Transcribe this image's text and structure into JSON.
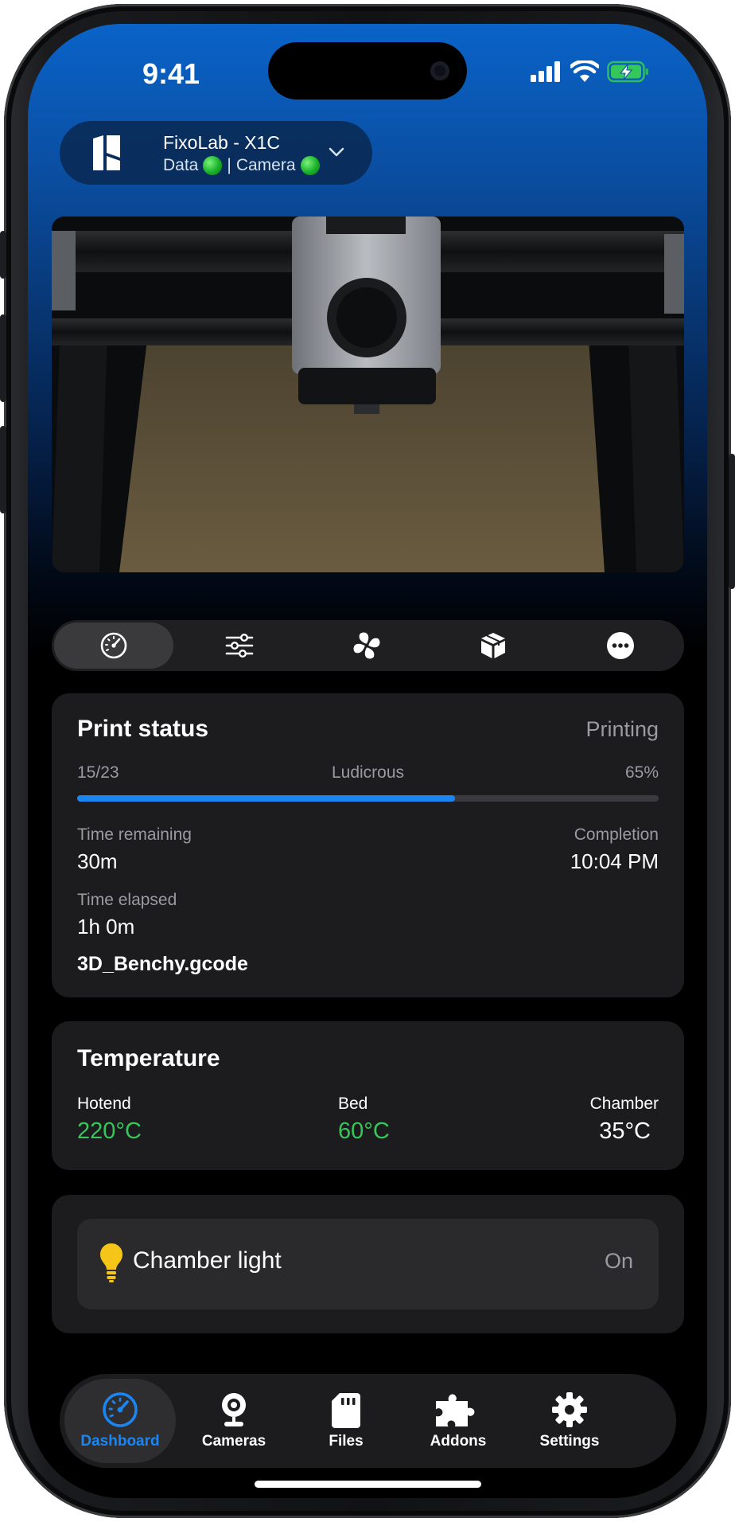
{
  "status_bar": {
    "time": "9:41"
  },
  "printer": {
    "name": "FixoLab - X1C",
    "data_label": "Data",
    "separator": "|",
    "camera_label": "Camera"
  },
  "segments": [
    {
      "icon": "speedometer-icon"
    },
    {
      "icon": "sliders-icon"
    },
    {
      "icon": "fan-icon"
    },
    {
      "icon": "box-icon"
    },
    {
      "icon": "more-icon"
    }
  ],
  "print_status": {
    "title": "Print status",
    "state": "Printing",
    "layer": "15/23",
    "speed_mode": "Ludicrous",
    "progress_label": "65%",
    "progress": 0.65,
    "time_remaining_label": "Time remaining",
    "time_remaining": "30m",
    "completion_label": "Completion",
    "completion": "10:04 PM",
    "time_elapsed_label": "Time elapsed",
    "time_elapsed": "1h 0m",
    "file_name": "3D_Benchy.gcode"
  },
  "temperature": {
    "title": "Temperature",
    "hotend_label": "Hotend",
    "hotend": "220°C",
    "bed_label": "Bed",
    "bed": "60°C",
    "chamber_label": "Chamber",
    "chamber": "35°C"
  },
  "chamber_light": {
    "label": "Chamber light",
    "state": "On"
  },
  "tabs": [
    {
      "label": "Dashboard",
      "icon": "dashboard-icon"
    },
    {
      "label": "Cameras",
      "icon": "webcam-icon"
    },
    {
      "label": "Files",
      "icon": "sd-card-icon"
    },
    {
      "label": "Addons",
      "icon": "puzzle-icon"
    },
    {
      "label": "Settings",
      "icon": "gear-icon"
    }
  ],
  "colors": {
    "accent": "#1b86f2",
    "temp_ok": "#34c759",
    "status_green": "#18b12a",
    "bulb": "#f5c518"
  }
}
